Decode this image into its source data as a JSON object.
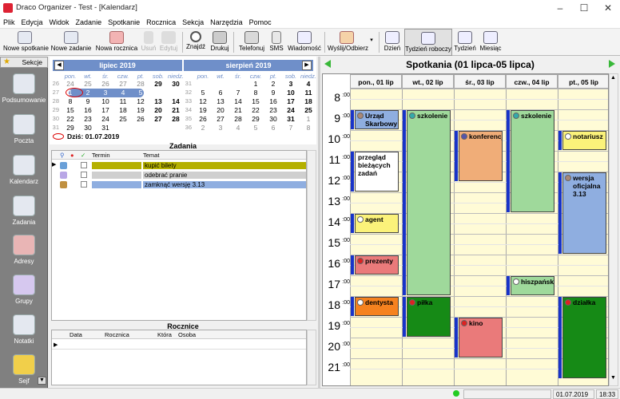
{
  "window": {
    "title": "Draco Organizer - Test - [Kalendarz]",
    "min": "–",
    "max": "☐",
    "close": "✕"
  },
  "menu": [
    "Plik",
    "Edycja",
    "Widok",
    "Zadanie",
    "Spotkanie",
    "Rocznica",
    "Sekcja",
    "Narzędzia",
    "Pomoc"
  ],
  "toolbar": {
    "nowe_spotkanie": "Nowe spotkanie",
    "nowe_zadanie": "Nowe zadanie",
    "nowa_rocznica": "Nowa rocznica",
    "usun": "Usuń",
    "edytuj": "Edytuj",
    "znajdz": "Znajdź",
    "drukuj": "Drukuj",
    "telefonuj": "Telefonuj",
    "sms": "SMS",
    "wiadomosc": "Wiadomość",
    "wyslij": "Wyślij/Odbierz",
    "dzien": "Dzień",
    "tydzien_roboczy": "Tydzień roboczy",
    "tydzien": "Tydzień",
    "miesiac": "Miesiąc"
  },
  "sidebar": {
    "header": "Sekcje",
    "items": [
      {
        "label": "Podsumowanie",
        "icon": "newspaper-icon"
      },
      {
        "label": "Poczta",
        "icon": "envelope-icon"
      },
      {
        "label": "Kalendarz",
        "icon": "calendar-icon"
      },
      {
        "label": "Zadania",
        "icon": "notepad-icon"
      },
      {
        "label": "Adresy",
        "icon": "address-book-icon"
      },
      {
        "label": "Grupy",
        "icon": "people-icon"
      },
      {
        "label": "Notatki",
        "icon": "note-icon"
      },
      {
        "label": "Sejf",
        "icon": "key-icon"
      }
    ]
  },
  "minical": {
    "july": {
      "title": "lipiec 2019"
    },
    "aug": {
      "title": "sierpień 2019"
    },
    "daynames": [
      "pon.",
      "wt.",
      "śr.",
      "czw.",
      "pt.",
      "sob.",
      "niedz."
    ],
    "july_weeks": [
      "26",
      "27",
      "28",
      "29",
      "30",
      "31"
    ],
    "aug_weeks": [
      "31",
      "32",
      "33",
      "34",
      "35",
      "36"
    ],
    "july_days": [
      [
        "24",
        "25",
        "26",
        "27",
        "28",
        "29",
        "30"
      ],
      [
        "1",
        "2",
        "3",
        "4",
        "5",
        "6",
        "7"
      ],
      [
        "8",
        "9",
        "10",
        "11",
        "12",
        "13",
        "14"
      ],
      [
        "15",
        "16",
        "17",
        "18",
        "19",
        "20",
        "21"
      ],
      [
        "22",
        "23",
        "24",
        "25",
        "26",
        "27",
        "28"
      ],
      [
        "29",
        "30",
        "31",
        "",
        "",
        "",
        ""
      ]
    ],
    "aug_days": [
      [
        "",
        "",
        "",
        "1",
        "2",
        "3",
        "4"
      ],
      [
        "5",
        "6",
        "7",
        "8",
        "9",
        "10",
        "11"
      ],
      [
        "12",
        "13",
        "14",
        "15",
        "16",
        "17",
        "18"
      ],
      [
        "19",
        "20",
        "21",
        "22",
        "23",
        "24",
        "25"
      ],
      [
        "26",
        "27",
        "28",
        "29",
        "30",
        "31",
        "1"
      ],
      [
        "2",
        "3",
        "4",
        "5",
        "6",
        "7",
        "8"
      ]
    ],
    "today": "Dziś: 01.07.2019"
  },
  "tasks": {
    "title": "Zadania",
    "cols": {
      "termin": "Termin",
      "temat": "Temat"
    },
    "rows": [
      {
        "temat": "kupić bilety",
        "color": "#b5b000",
        "icon": "anchor-icon"
      },
      {
        "temat": "odebrać pranie",
        "color": "#cfcfcf",
        "icon": "bulb-icon"
      },
      {
        "temat": "zamknąć wersję 3.13",
        "color": "#8faee0",
        "icon": "bag-icon"
      }
    ]
  },
  "anniv": {
    "title": "Rocznice",
    "cols": {
      "data": "Data",
      "rocznica": "Rocznica",
      "ktora": "Która",
      "osoba": "Osoba"
    }
  },
  "schedule": {
    "title": "Spotkania (01 lipca-05 lipca)",
    "days": [
      "pon., 01 lip",
      "wt., 02 lip",
      "śr., 03 lip",
      "czw., 04 lip",
      "pt., 05 lip"
    ],
    "hours": [
      "8",
      "9",
      "10",
      "11",
      "12",
      "13",
      "14",
      "15",
      "16",
      "17",
      "18",
      "19",
      "20",
      "21"
    ],
    "minute_label": ":00",
    "events": [
      {
        "day": 0,
        "start": 9,
        "end": 10,
        "text": "Urząd Skarbowy",
        "color": "#8faee0",
        "dot": "#a87"
      },
      {
        "day": 0,
        "start": 11,
        "end": 13,
        "text": "przegląd bieżących zadań",
        "color": "#ffffff",
        "dot": ""
      },
      {
        "day": 0,
        "start": 14,
        "end": 15,
        "text": "agent",
        "color": "#fbf27a",
        "dot": "#fff"
      },
      {
        "day": 0,
        "start": 16,
        "end": 17,
        "text": "prezenty",
        "color": "#ea7a7a",
        "dot": "#d22"
      },
      {
        "day": 0,
        "start": 18,
        "end": 19,
        "text": "dentysta",
        "color": "#f5821f",
        "dot": "#fff"
      },
      {
        "day": 1,
        "start": 9,
        "end": 18,
        "text": "szkolenie",
        "color": "#9fd99b",
        "dot": "#3aa"
      },
      {
        "day": 1,
        "start": 18,
        "end": 20,
        "text": "piłka",
        "color": "#168a16",
        "dot": "#d22"
      },
      {
        "day": 2,
        "start": 10,
        "end": 12.5,
        "text": "konferencja",
        "color": "#f0ad78",
        "dot": "#55a"
      },
      {
        "day": 2,
        "start": 19,
        "end": 21,
        "text": "kino",
        "color": "#ea7a7a",
        "dot": "#d22"
      },
      {
        "day": 3,
        "start": 9,
        "end": 14,
        "text": "szkolenie",
        "color": "#9fd99b",
        "dot": "#3aa"
      },
      {
        "day": 3,
        "start": 17,
        "end": 18,
        "text": "hiszpański",
        "color": "#9fd99b",
        "dot": "#fff"
      },
      {
        "day": 4,
        "start": 10,
        "end": 11,
        "text": "notariusz",
        "color": "#fbf27a",
        "dot": "#fff"
      },
      {
        "day": 4,
        "start": 12,
        "end": 16,
        "text": "wersja oficjalna 3.13",
        "color": "#8faee0",
        "dot": "#a87"
      },
      {
        "day": 4,
        "start": 18,
        "end": 22,
        "text": "działka",
        "color": "#168a16",
        "dot": "#d22"
      }
    ]
  },
  "status": {
    "date": "01.07.2019",
    "time": "18:33"
  }
}
